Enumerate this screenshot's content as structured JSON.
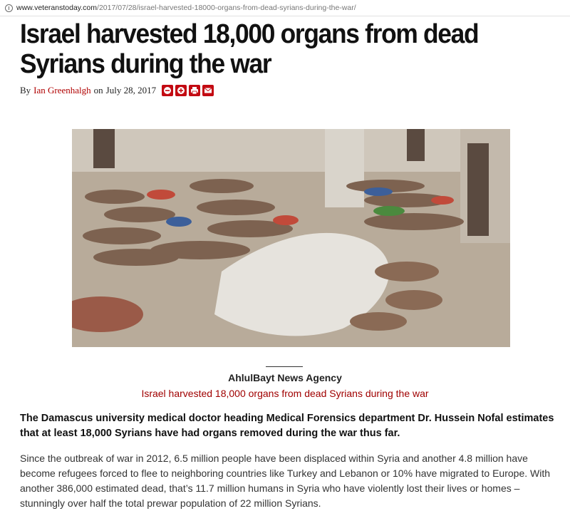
{
  "address_bar": {
    "host": "www.veteranstoday.com",
    "path": "/2017/07/28/israel-harvested-18000-organs-from-dead-syrians-during-the-war/"
  },
  "article": {
    "title": "Israel harvested 18,000 organs from dead Syrians during the war",
    "byline_prefix": "By",
    "author": "Ian Greenhalgh",
    "date_prefix": "on",
    "date": "July 28, 2017",
    "share_icons": [
      "minus-circle-icon",
      "plus-circle-icon",
      "print-icon",
      "email-icon"
    ],
    "caption": {
      "source": "AhlulBayt News Agency",
      "headline": "Israel harvested 18,000 organs from dead Syrians during the war"
    },
    "lead": "The Damascus university medical doctor heading Medical Forensics department Dr. Hussein Nofal estimates that at least 18,000 Syrians have had organs removed during the war thus far.",
    "paragraph": "Since the outbreak of war in 2012, 6.5 million people have been displaced within Syria and another 4.8 million have become refugees forced to flee to neighboring countries like Turkey and Lebanon or 10% have migrated to Europe. With another 386,000 estimated dead, that’s 11.7 million humans in Syria who have violently lost their lives or homes – stunningly over half the total prewar population of 22 million Syrians."
  },
  "colors": {
    "accent": "#c30a12",
    "author_link": "#b00000",
    "caption_headline": "#a00000"
  }
}
